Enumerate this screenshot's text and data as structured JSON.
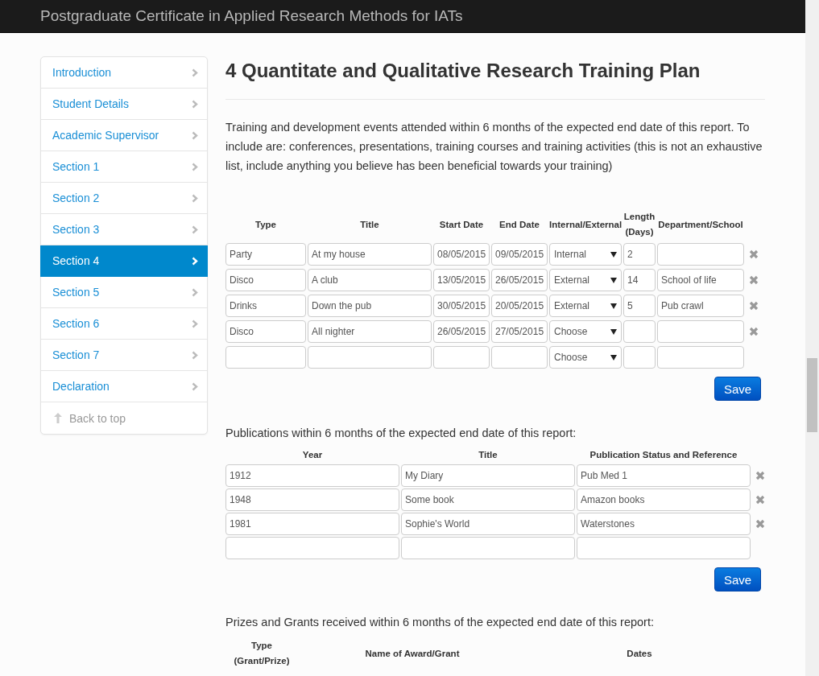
{
  "header": {
    "title": "Postgraduate Certificate in Applied Research Methods for IATs"
  },
  "sidebar": {
    "items": [
      {
        "label": "Introduction",
        "selected": false
      },
      {
        "label": "Student Details",
        "selected": false
      },
      {
        "label": "Academic Supervisor",
        "selected": false
      },
      {
        "label": "Section 1",
        "selected": false
      },
      {
        "label": "Section 2",
        "selected": false
      },
      {
        "label": "Section 3",
        "selected": false
      },
      {
        "label": "Section 4",
        "selected": true
      },
      {
        "label": "Section 5",
        "selected": false
      },
      {
        "label": "Section 6",
        "selected": false
      },
      {
        "label": "Section 7",
        "selected": false
      },
      {
        "label": "Declaration",
        "selected": false
      }
    ],
    "back_to_top": "Back to top"
  },
  "heading": "4 Quantitate and Qualitative Research Training Plan",
  "intro": "Training and development events attended within 6 months of the expected end date of this report. To include are: conferences, presentations, training courses and training activities (this is not an exhaustive list, include anything you believe has been beneficial towards your training)",
  "training": {
    "columns": [
      "Type",
      "Title",
      "Start Date",
      "End Date",
      "Internal/External",
      "Length (Days)",
      "Department/School"
    ],
    "rows": [
      {
        "type": "Party",
        "title": "At my house",
        "start_date": "08/05/2015",
        "end_date": "09/05/2015",
        "internal_external": "Internal",
        "length_days": "2",
        "removable": true
      },
      {
        "type": "Disco",
        "title": "A club",
        "start_date": "13/05/2015",
        "end_date": "26/05/2015",
        "internal_external": "External",
        "length_days": "14",
        "department": "School of life",
        "removable": true
      },
      {
        "type": "Drinks",
        "title": "Down the pub",
        "start_date": "30/05/2015",
        "end_date": "20/05/2015",
        "internal_external": "External",
        "length_days": "5",
        "department": "Pub crawl",
        "removable": true
      },
      {
        "type": "Disco",
        "title": "All nighter",
        "start_date": "26/05/2015",
        "end_date": "27/05/2015",
        "internal_external": "Choose",
        "removable": true
      },
      {
        "internal_external": "Choose",
        "removable": false
      }
    ],
    "save": "Save"
  },
  "publications": {
    "intro": "Publications within 6 months of the expected end date of this report:",
    "columns": [
      "Year",
      "Title",
      "Publication Status and Reference"
    ],
    "rows": [
      {
        "year": "1912",
        "title": "My Diary",
        "status": "Pub Med 1",
        "removable": true
      },
      {
        "year": "1948",
        "title": "Some book",
        "status": "Amazon books",
        "removable": true
      },
      {
        "year": "1981",
        "title": "Sophie's World",
        "status": "Waterstones",
        "removable": true
      },
      {
        "removable": false
      }
    ],
    "save": "Save"
  },
  "prizes": {
    "intro": "Prizes and Grants received within 6 months of the expected end date of this report:",
    "columns": [
      "Type (Grant/Prize)",
      "Name of Award/Grant",
      "Dates"
    ]
  }
}
